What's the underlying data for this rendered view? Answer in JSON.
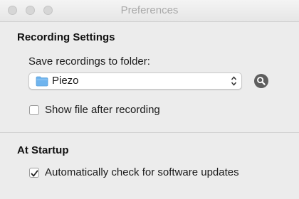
{
  "window": {
    "title": "Preferences"
  },
  "recording": {
    "heading": "Recording Settings",
    "folder_label": "Save recordings to folder:",
    "folder_value": "Piezo",
    "show_after_label": "Show file after recording",
    "show_after_checked": false
  },
  "startup": {
    "heading": "At Startup",
    "auto_update_label": "Automatically check for software updates",
    "auto_update_checked": true
  },
  "colors": {
    "folder_blue": "#6fb4ee",
    "reveal_button": "#5e5e5e"
  }
}
